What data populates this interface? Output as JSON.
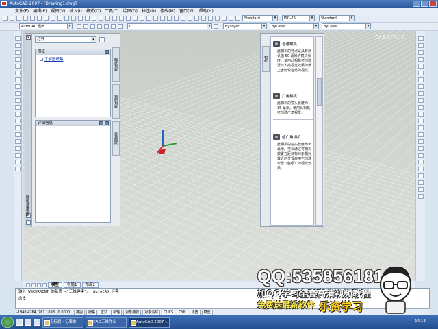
{
  "window": {
    "title": "AutoCAD 2007 - [Drawing1.dwg]"
  },
  "menu": [
    "文件(F)",
    "编辑(E)",
    "视图(V)",
    "插入(I)",
    "格式(O)",
    "工具(T)",
    "绘图(D)",
    "标注(N)",
    "修改(M)",
    "窗口(W)",
    "帮助(H)"
  ],
  "toolbar": {
    "workspace": "AutoCAD 经典",
    "text_style": "Standard",
    "dim_style": "ISO-25",
    "table_style": "Standard",
    "layer": "0",
    "color": "ByLayer",
    "linetype": "ByLayer",
    "lineweight": "ByLayer"
  },
  "palette": {
    "open_dropdown": "打开...",
    "panel1_title": "图纸",
    "panel1_link": "了解图纸集",
    "panel2_title": "详细信息",
    "tabs": [
      "图纸列表",
      "视图列表",
      "资源图形"
    ],
    "vertical_title": "图纸集管理器"
  },
  "camera_panel": {
    "tab": "相机",
    "items": [
      {
        "title": "普通相机",
        "desc": "此相机的特点是具有默认值 50 毫米的镜头长度。使用此相机可创建近似人类视觉效果的景上含比较自然的视觉。"
      },
      {
        "title": "广角相机",
        "desc": "此相机的镜头长度为 35 毫米。使用此相机可创建广角视觉。"
      },
      {
        "title": "超广角相机",
        "desc": "此相机的镜头长度为 6 毫米。可以通过将相机放置在距目标对象相对较近的位置来用它创建夸张（鱼眼）的视觉效果。"
      }
    ]
  },
  "layout_tabs": [
    "模型",
    "布局1",
    "布局2"
  ],
  "command": {
    "line1": "输入 WSCURRENT 的新值 <\"三维建模\">: AutoCAD 经典",
    "line2": "命令:"
  },
  "status": {
    "coords": "-1940.4264, 761.1698 , 0.0000",
    "buttons": [
      "捕捉",
      "栅格",
      "正交",
      "极轴",
      "对象捕捉",
      "对象追踪",
      "DUCS",
      "DYN",
      "线宽",
      "模型"
    ]
  },
  "taskbar": {
    "tasks": [
      "无标题 - 记事本",
      "CAD三维作业",
      "AutoCAD 2007 -..."
    ],
    "clock": "14:13"
  },
  "watermark": {
    "site": "tv.sohu.c",
    "qq": "QQ:535856181",
    "line2": "加QQ学习全套高清视频教程",
    "line3": "免费送最新软件",
    "line4": "乐资学习"
  },
  "colors": {
    "accent": "#2c5aa0",
    "canvas": "#d3d6d0",
    "watermark_yellow": "#ffcf1a"
  }
}
